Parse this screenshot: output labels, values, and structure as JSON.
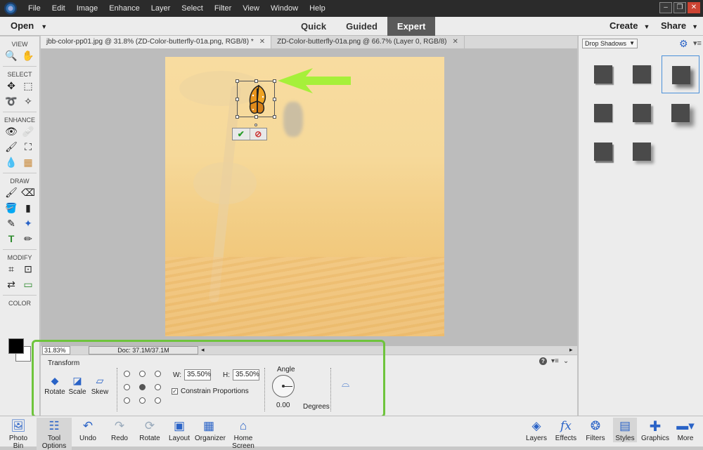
{
  "menu": {
    "items": [
      "File",
      "Edit",
      "Image",
      "Enhance",
      "Layer",
      "Select",
      "Filter",
      "View",
      "Window",
      "Help"
    ]
  },
  "modebar": {
    "open_label": "Open",
    "modes": [
      {
        "label": "Quick",
        "active": false
      },
      {
        "label": "Guided",
        "active": false
      },
      {
        "label": "Expert",
        "active": true
      }
    ],
    "create_label": "Create",
    "share_label": "Share"
  },
  "toolbox": {
    "view": "VIEW",
    "select": "SELECT",
    "enhance": "ENHANCE",
    "draw": "DRAW",
    "modify": "MODIFY",
    "color": "COLOR"
  },
  "tabs": [
    {
      "label": "jbb-color-pp01.jpg @ 31.8% (ZD-Color-butterfly-01a.png, RGB/8) *",
      "active": true
    },
    {
      "label": "ZD-Color-butterfly-01a.png @ 66.7% (Layer 0, RGB/8)",
      "active": false
    }
  ],
  "status": {
    "zoom": "31.83%",
    "doc": "Doc: 37.1M/37.1M"
  },
  "transform": {
    "title": "Transform",
    "rotate": "Rotate",
    "scale": "Scale",
    "skew": "Skew",
    "w_label": "W:",
    "w_value": "35.50%",
    "h_label": "H:",
    "h_value": "35.50%",
    "constrain": "Constrain Proportions",
    "angle_label": "Angle",
    "angle_value": "0.00",
    "degrees": "Degrees"
  },
  "rightpanel": {
    "category": "Drop Shadows"
  },
  "taskbar": {
    "photo_bin": "Photo Bin",
    "tool_options": "Tool Options",
    "undo": "Undo",
    "redo": "Redo",
    "rotate": "Rotate",
    "layout": "Layout",
    "organizer": "Organizer",
    "home_screen": "Home Screen",
    "layers": "Layers",
    "effects": "Effects",
    "filters": "Filters",
    "styles": "Styles",
    "graphics": "Graphics",
    "more": "More"
  },
  "colors": {
    "accent": "#2a63c7",
    "highlight": "#6ec43c",
    "arrow": "#a6f03a"
  }
}
